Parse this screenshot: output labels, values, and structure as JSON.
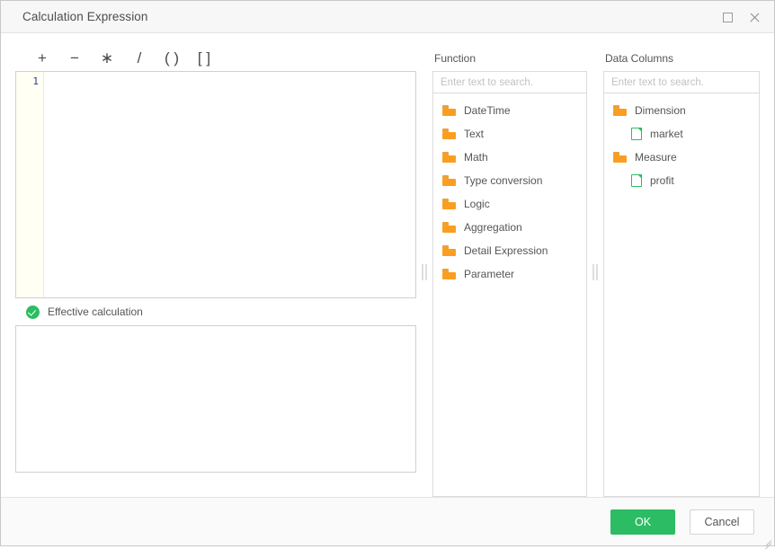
{
  "window": {
    "title": "Calculation Expression",
    "controls": {
      "maximize": "Maximize",
      "close": "Close"
    }
  },
  "editor": {
    "operators": [
      "+",
      "−",
      "∗",
      "/",
      "( )",
      "[ ]"
    ],
    "line_number": "1",
    "expression": "",
    "status": {
      "text": "Effective calculation",
      "icon": "check-circle-icon",
      "color": "#2cbc63"
    },
    "result": ""
  },
  "function_panel": {
    "title": "Function",
    "search_placeholder": "Enter text to search.",
    "search_value": "",
    "items": [
      {
        "label": "DateTime",
        "type": "folder",
        "level": 0
      },
      {
        "label": "Text",
        "type": "folder",
        "level": 0
      },
      {
        "label": "Math",
        "type": "folder",
        "level": 0
      },
      {
        "label": "Type conversion",
        "type": "folder",
        "level": 0
      },
      {
        "label": "Logic",
        "type": "folder",
        "level": 0
      },
      {
        "label": "Aggregation",
        "type": "folder",
        "level": 0
      },
      {
        "label": "Detail Expression",
        "type": "folder",
        "level": 0
      },
      {
        "label": "Parameter",
        "type": "folder",
        "level": 0
      }
    ]
  },
  "data_columns_panel": {
    "title": "Data Columns",
    "search_placeholder": "Enter text to search.",
    "search_value": "",
    "items": [
      {
        "label": "Dimension",
        "type": "folder",
        "level": 0
      },
      {
        "label": "market",
        "type": "file",
        "level": 1
      },
      {
        "label": "Measure",
        "type": "folder",
        "level": 0
      },
      {
        "label": "profit",
        "type": "file",
        "level": 1
      }
    ]
  },
  "footer": {
    "ok_label": "OK",
    "cancel_label": "Cancel"
  },
  "colors": {
    "accent_green": "#2cbc63",
    "folder_orange": "#fa9e21",
    "line_number_blue": "#2c3e8f",
    "border_gray": "#dcdcdc"
  }
}
